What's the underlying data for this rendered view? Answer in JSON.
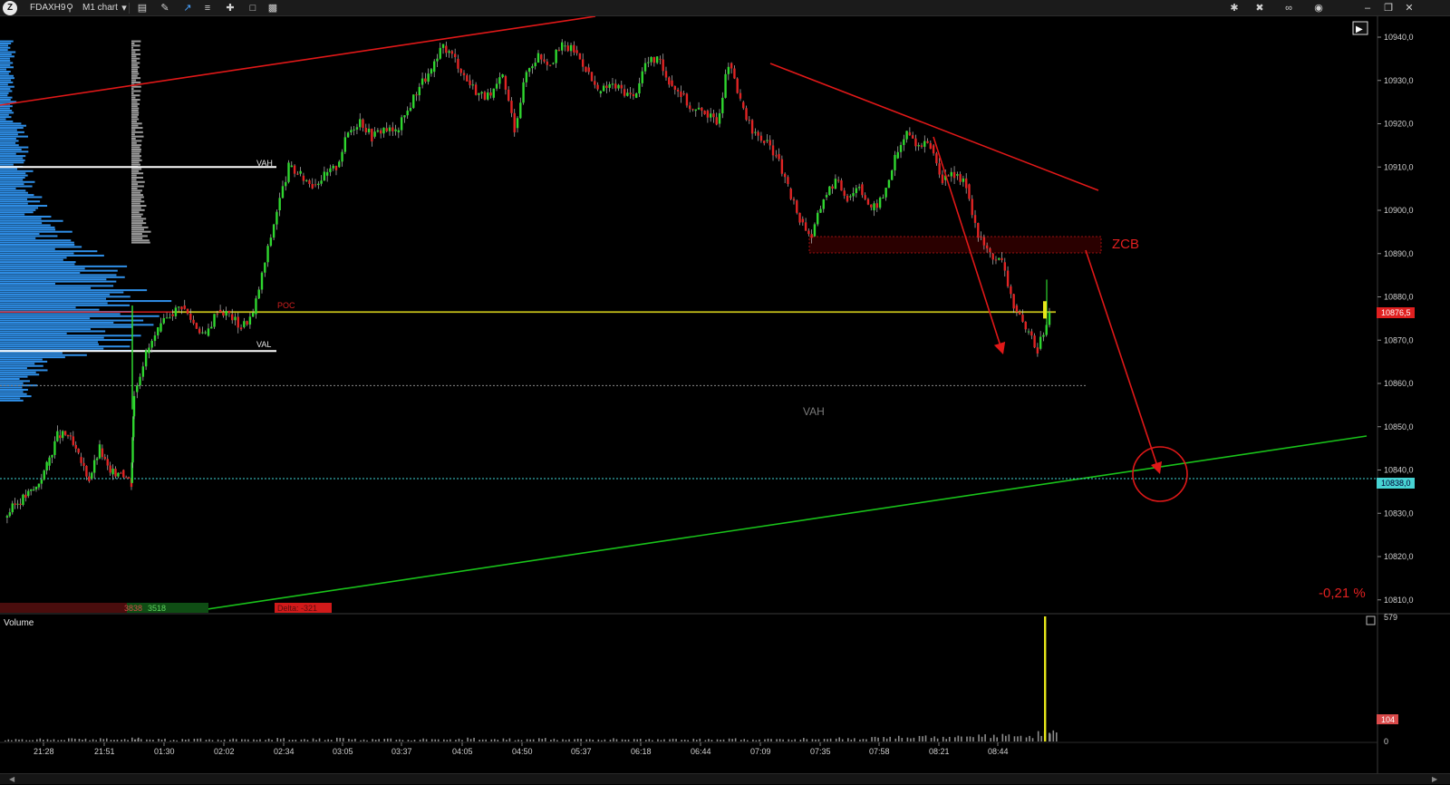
{
  "toolbar": {
    "logo": "Z",
    "symbol": "FDAXH9",
    "chart_type": "M1 chart",
    "icons": [
      "search-icon",
      "bars-style-icon",
      "draw-pen-icon",
      "chart-line-icon",
      "layers-icon",
      "crosshair-icon",
      "window-icon",
      "template-icon",
      "tools-icon",
      "link-icon",
      "camera-icon",
      "minimize-icon",
      "maximize-icon",
      "close-icon"
    ]
  },
  "chart_data": {
    "type": "line",
    "instrument": "FDAXH9",
    "timeframe": "M1",
    "y_ticks": [
      "10940,0",
      "10930,0",
      "10920,0",
      "10910,0",
      "10900,0",
      "10890,0",
      "10880,0",
      "10870,0",
      "10860,0",
      "10850,0",
      "10840,0",
      "10830,0",
      "10820,0",
      "10810,0"
    ],
    "ylim": [
      10807.5,
      10943
    ],
    "x_ticks": [
      "21:28",
      "21:51",
      "01:30",
      "02:02",
      "02:34",
      "03:05",
      "03:37",
      "04:05",
      "04:50",
      "05:37",
      "06:18",
      "06:44",
      "07:09",
      "07:35",
      "07:58",
      "08:21",
      "08:44"
    ],
    "price_path": [
      [
        0,
        10829
      ],
      [
        1,
        10832
      ],
      [
        2,
        10834
      ],
      [
        3,
        10836
      ],
      [
        4,
        10841
      ],
      [
        5,
        10848
      ],
      [
        6,
        10848
      ],
      [
        7,
        10843
      ],
      [
        8,
        10838
      ],
      [
        9,
        10845
      ],
      [
        10,
        10839
      ],
      [
        11,
        10840
      ],
      [
        12,
        10837
      ],
      [
        13,
        10858
      ],
      [
        14,
        10867
      ],
      [
        15,
        10872
      ],
      [
        16,
        10876
      ],
      [
        17,
        10878
      ],
      [
        18,
        10874
      ],
      [
        19,
        10871
      ],
      [
        20,
        10877
      ],
      [
        21,
        10876
      ],
      [
        22,
        10873
      ],
      [
        23,
        10876
      ],
      [
        24,
        10888
      ],
      [
        25,
        10900
      ],
      [
        26,
        10910
      ],
      [
        27,
        10908
      ],
      [
        28,
        10906
      ],
      [
        29,
        10908
      ],
      [
        30,
        10910
      ],
      [
        31,
        10918
      ],
      [
        32,
        10921
      ],
      [
        33,
        10917
      ],
      [
        34,
        10919
      ],
      [
        35,
        10918
      ],
      [
        36,
        10923
      ],
      [
        37,
        10929
      ],
      [
        38,
        10932
      ],
      [
        39,
        10938
      ],
      [
        40,
        10935
      ],
      [
        41,
        10930
      ],
      [
        42,
        10927
      ],
      [
        43,
        10926
      ],
      [
        44,
        10931
      ],
      [
        45,
        10919
      ],
      [
        46,
        10932
      ],
      [
        47,
        10936
      ],
      [
        48,
        10934
      ],
      [
        49,
        10938
      ],
      [
        50,
        10937
      ],
      [
        51,
        10933
      ],
      [
        52,
        10927
      ],
      [
        53,
        10929
      ],
      [
        54,
        10928
      ],
      [
        55,
        10926
      ],
      [
        56,
        10934
      ],
      [
        57,
        10935
      ],
      [
        58,
        10930
      ],
      [
        59,
        10927
      ],
      [
        60,
        10923
      ],
      [
        61,
        10923
      ],
      [
        62,
        10920
      ],
      [
        63,
        10934
      ],
      [
        64,
        10925
      ],
      [
        65,
        10918
      ],
      [
        66,
        10916
      ],
      [
        67,
        10913
      ],
      [
        68,
        10905
      ],
      [
        69,
        10898
      ],
      [
        70,
        10894
      ],
      [
        71,
        10903
      ],
      [
        72,
        10907
      ],
      [
        73,
        10903
      ],
      [
        74,
        10906
      ],
      [
        75,
        10900
      ],
      [
        76,
        10903
      ],
      [
        77,
        10912
      ],
      [
        78,
        10918
      ],
      [
        79,
        10915
      ],
      [
        80,
        10915
      ],
      [
        81,
        10907
      ],
      [
        82,
        10908
      ],
      [
        83,
        10906
      ],
      [
        84,
        10894
      ],
      [
        85,
        10890
      ],
      [
        86,
        10888
      ],
      [
        87,
        10878
      ],
      [
        88,
        10872
      ],
      [
        89,
        10868
      ],
      [
        90,
        10876
      ]
    ],
    "volume_values": [
      8,
      10,
      6,
      12,
      9,
      7,
      14,
      11,
      9,
      13,
      8,
      10,
      15,
      12,
      9,
      11,
      7,
      10,
      13,
      9,
      8,
      12,
      10,
      9,
      11,
      14,
      8,
      10,
      12,
      9,
      16,
      11,
      8,
      10,
      13,
      9,
      7,
      12,
      10,
      9,
      11,
      15,
      9,
      10,
      12,
      8,
      10,
      14,
      11,
      9,
      12,
      10,
      8,
      13,
      9,
      11,
      10,
      9,
      12,
      8,
      11,
      10,
      9,
      13,
      10,
      8,
      12,
      11,
      9,
      14,
      10,
      12,
      16,
      13,
      11,
      20,
      18,
      22,
      16,
      25,
      20,
      18,
      24,
      22,
      28,
      26,
      30,
      24,
      22,
      40,
      45
    ],
    "volume_spike": 579,
    "volume_axis": {
      "top_label": "579",
      "mid_label": "104",
      "bottom_label": "0"
    },
    "levels": {
      "VAH": 10910,
      "POC": 10876.5,
      "VAL": 10867.5,
      "dashed_gray": 10859.5,
      "current": 10838
    },
    "annotations": {
      "vah_label": "VAH",
      "poc_label": "POC",
      "val_label": "VAL",
      "vah_label_2": "VAH",
      "zone_label": "ZCB",
      "percent_change": "-0,21 %",
      "price_badge": "10876,5",
      "current_badge": "10838,0",
      "volume_title": "Volume",
      "volume_badge": "104",
      "delta_sell": "3838",
      "delta_buy": "3518",
      "delta_label": "Delta: -321"
    },
    "grid": false
  }
}
